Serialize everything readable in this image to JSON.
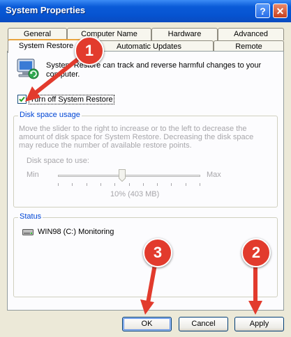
{
  "window": {
    "title": "System Properties",
    "help_glyph": "?",
    "close_glyph": "✕"
  },
  "tabs_row1": [
    "General",
    "Computer Name",
    "Hardware",
    "Advanced"
  ],
  "tabs_row2": [
    "System Restore",
    "Automatic Updates",
    "Remote"
  ],
  "intro": {
    "text": "System Restore can track and reverse harmful changes to your computer."
  },
  "turn_off": {
    "label": "Turn off System Restore",
    "checked": true
  },
  "disk_usage": {
    "label": "Disk space usage",
    "description": "Move the slider to the right to increase or to the left to decrease the amount of disk space for System Restore. Decreasing the disk space may reduce the number of available restore points.",
    "slider_label": "Disk space to use:",
    "min_label": "Min",
    "max_label": "Max",
    "value_text": "10% (403 MB)",
    "value_fraction": 0.45
  },
  "status": {
    "label": "Status",
    "drive": "WIN98 (C:)",
    "state": "Monitoring"
  },
  "buttons": {
    "ok": "OK",
    "cancel": "Cancel",
    "apply": "Apply"
  },
  "annotations": {
    "step1": "1",
    "step2": "2",
    "step3": "3",
    "color": "#e23b2d"
  }
}
